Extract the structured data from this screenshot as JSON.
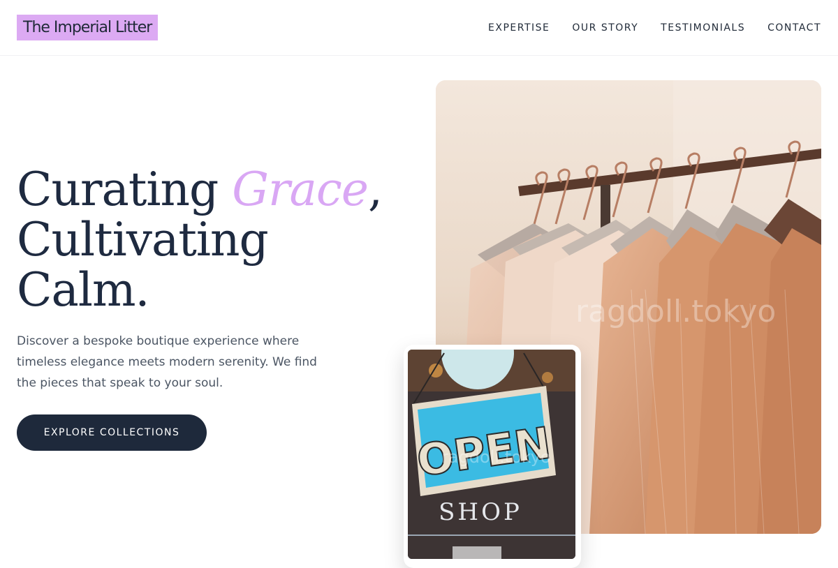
{
  "header": {
    "logo": "The Imperial Litter",
    "nav": [
      "EXPERTISE",
      "OUR STORY",
      "TESTIMONIALS",
      "CONTACT"
    ]
  },
  "hero": {
    "headline_part1": "Curating ",
    "headline_accent": "Grace",
    "headline_part2": ",",
    "headline_line2": "Cultivating",
    "headline_line3": "Calm.",
    "description": "Discover a bespoke boutique experience where timeless elegance meets modern serenity. We find the pieces that speak to your soul.",
    "cta": "EXPLORE COLLECTIONS"
  },
  "images": {
    "main_watermark": "ragdoll.tokyo",
    "sign_open": "OPEN",
    "sign_shop": "SHOP",
    "card_watermark": "ragdoll.tokyo"
  },
  "colors": {
    "accent": "#d9a7f4",
    "logo_bg": "#dcaaf3",
    "dark": "#1e293b",
    "text": "#4b5563"
  }
}
